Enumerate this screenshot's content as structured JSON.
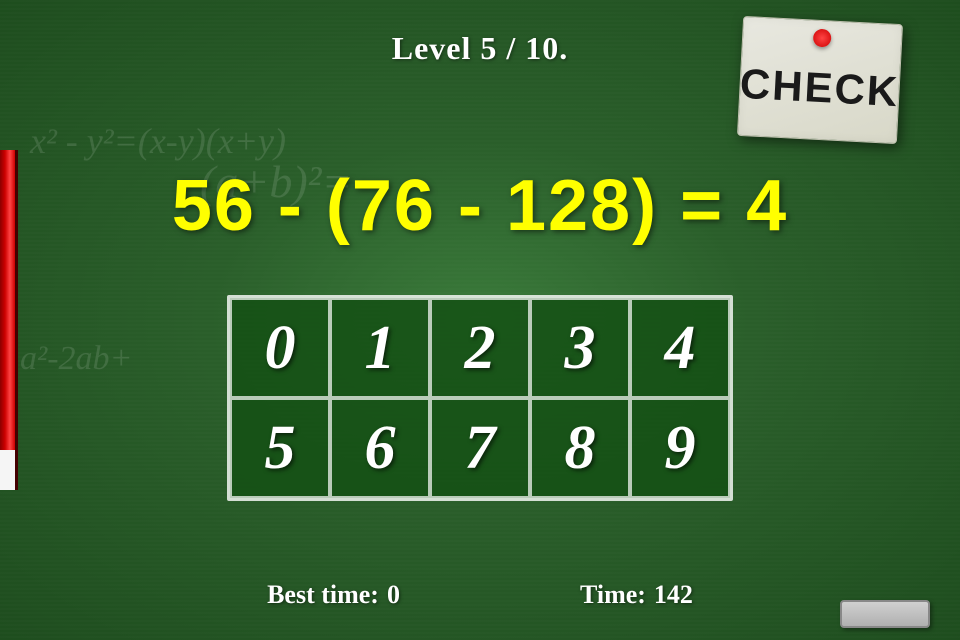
{
  "header": {
    "level_label": "Level 5 / 10."
  },
  "check_button": {
    "label": "CHECK"
  },
  "equation": {
    "text": "56 - (76 - 128) = 4"
  },
  "bg_formulas": {
    "formula1": "x² - y²=(x-y)(x+y)",
    "formula2": "(a+b)²=",
    "formula3": "a²-2ab+"
  },
  "number_grid": {
    "rows": [
      [
        {
          "value": "0"
        },
        {
          "value": "1"
        },
        {
          "value": "2"
        },
        {
          "value": "3"
        },
        {
          "value": "4"
        }
      ],
      [
        {
          "value": "5"
        },
        {
          "value": "6"
        },
        {
          "value": "7"
        },
        {
          "value": "8"
        },
        {
          "value": "9"
        }
      ]
    ]
  },
  "stats": {
    "best_time_label": "Best time:",
    "best_time_value": "0",
    "time_label": "Time:",
    "time_value": "142"
  },
  "colors": {
    "board_bg": "#2a5e2a",
    "equation_color": "#ffff00",
    "cell_bg": "#145014"
  }
}
